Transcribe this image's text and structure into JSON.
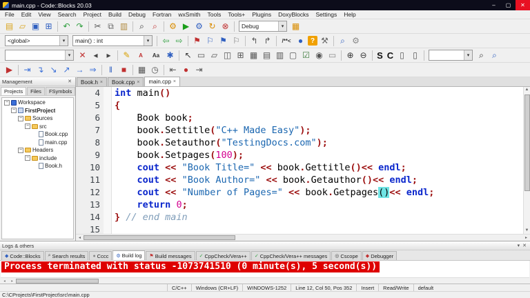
{
  "window": {
    "title": "main.cpp - Code::Blocks 20.03",
    "minimize": "–",
    "maximize": "▢",
    "close": "✕"
  },
  "menubar": [
    "File",
    "Edit",
    "View",
    "Search",
    "Project",
    "Build",
    "Debug",
    "Fortran",
    "wxSmith",
    "Tools",
    "Tools+",
    "Plugins",
    "DoxyBlocks",
    "Settings",
    "Help"
  ],
  "toolbars": {
    "debug_combo": "Debug",
    "scope_combo": "<global>",
    "symbol_combo": "main() : int",
    "row3_combo": "",
    "search_combo": "",
    "row1": [
      {
        "name": "new-file-icon",
        "glyph": "▤",
        "color": "#d9a520"
      },
      {
        "name": "open-file-icon",
        "glyph": "▱",
        "color": "#d9a520"
      },
      {
        "name": "save-icon",
        "glyph": "▣",
        "color": "#2f5fc0"
      },
      {
        "name": "save-all-icon",
        "glyph": "⊞",
        "color": "#2f5fc0"
      },
      {
        "sep": true
      },
      {
        "name": "undo-icon",
        "glyph": "↶",
        "color": "#2e9e3e"
      },
      {
        "name": "redo-icon",
        "glyph": "↷",
        "color": "#2e9e3e"
      },
      {
        "sep": true
      },
      {
        "name": "cut-icon",
        "glyph": "✂",
        "color": "#555555"
      },
      {
        "name": "copy-icon",
        "glyph": "⧉",
        "color": "#666666"
      },
      {
        "name": "paste-icon",
        "glyph": "▥",
        "color": "#b08a40"
      },
      {
        "sep": true
      },
      {
        "name": "find-icon",
        "glyph": "⌕",
        "color": "#333333"
      },
      {
        "name": "replace-icon",
        "glyph": "⌕",
        "color": "#c03030"
      },
      {
        "sep": true
      },
      {
        "name": "build-icon",
        "glyph": "⚙",
        "color": "#d98c00"
      },
      {
        "name": "run-icon",
        "glyph": "▶",
        "color": "#1a9e1a"
      },
      {
        "name": "build-and-run-icon",
        "glyph": "⚙",
        "color": "#2f5fc0"
      },
      {
        "name": "rebuild-icon",
        "glyph": "↻",
        "color": "#d98c00"
      },
      {
        "name": "abort-icon",
        "glyph": "⊗",
        "color": "#c03030"
      },
      {
        "sep": true
      }
    ],
    "row1b": [
      {
        "name": "select-target-icon",
        "glyph": "▦",
        "color": "#d98c00"
      }
    ],
    "row2": [
      {
        "sep": true
      },
      {
        "name": "goto-back-icon",
        "glyph": "⇦",
        "color": "#2e9e3e"
      },
      {
        "name": "goto-forward-icon",
        "glyph": "⇨",
        "color": "#2e9e3e"
      },
      {
        "sep": true
      },
      {
        "name": "toggle-bookmark-icon",
        "glyph": "⚑",
        "color": "#c03030"
      },
      {
        "name": "prev-bookmark-icon",
        "glyph": "⚐",
        "color": "#2f5fc0"
      },
      {
        "name": "next-bookmark-icon",
        "glyph": "⚑",
        "color": "#2f5fc0"
      },
      {
        "name": "clear-bookmarks-icon",
        "glyph": "⚐",
        "color": "#777777"
      },
      {
        "sep": true
      },
      {
        "name": "goto-declaration-icon",
        "glyph": "↰",
        "color": "#555555"
      },
      {
        "name": "goto-implementation-icon",
        "glyph": "↱",
        "color": "#555555"
      },
      {
        "sep": true
      },
      {
        "name": "doxy-block-comment-icon",
        "glyph": "/**<",
        "color": "#333333",
        "cls": "txt"
      },
      {
        "name": "doxy-run-icon",
        "glyph": "●",
        "color": "#2f5fc0"
      },
      {
        "name": "doxy-help-icon",
        "glyph": "?",
        "color": "#ffffff",
        "cls": "qbox"
      },
      {
        "name": "doxy-settings-icon",
        "glyph": "⚒",
        "color": "#666666"
      },
      {
        "sep": true
      },
      {
        "name": "find-in-files-icon",
        "glyph": "⌕",
        "color": "#2f5fc0"
      },
      {
        "name": "environment-options-icon",
        "glyph": "⚙",
        "color": "#888888"
      }
    ],
    "row3": [
      {
        "name": "incsearch-clear-icon",
        "glyph": "✕",
        "color": "#c03030"
      },
      {
        "name": "incsearch-prev-icon",
        "glyph": "◂",
        "color": "#444444"
      },
      {
        "name": "incsearch-next-icon",
        "glyph": "▸",
        "color": "#444444"
      },
      {
        "sep": true
      },
      {
        "name": "highlight-pen-icon",
        "glyph": "✎",
        "color": "#d8a000"
      },
      {
        "name": "highlight-a-icon",
        "glyph": "A",
        "color": "#c03030",
        "cls": "txt"
      },
      {
        "name": "match-case-icon",
        "glyph": "Aa",
        "color": "#333333",
        "cls": "txt"
      },
      {
        "name": "selection-star-icon",
        "glyph": "✱",
        "color": "#2f5fc0"
      },
      {
        "sep": true
      },
      {
        "name": "pointer-tool-icon",
        "glyph": "↖",
        "color": "#333333"
      },
      {
        "name": "frame-widget-icon",
        "glyph": "▭",
        "color": "#555555"
      },
      {
        "name": "panel-widget-icon",
        "glyph": "▱",
        "color": "#555555"
      },
      {
        "name": "splitter-widget-icon",
        "glyph": "◫",
        "color": "#555555"
      },
      {
        "name": "notebook-widget-icon",
        "glyph": "⊞",
        "color": "#555555"
      },
      {
        "name": "sizer-widget-icon",
        "glyph": "▦",
        "color": "#555555"
      },
      {
        "name": "grid-widget-icon",
        "glyph": "▤",
        "color": "#555555"
      },
      {
        "name": "listbox-widget-icon",
        "glyph": "▥",
        "color": "#555555"
      },
      {
        "name": "button-widget-icon",
        "glyph": "▢",
        "color": "#555555"
      },
      {
        "name": "checkbox-widget-icon",
        "glyph": "☑",
        "color": "#3a7a3a"
      },
      {
        "name": "radio-widget-icon",
        "glyph": "◉",
        "color": "#555555"
      },
      {
        "name": "statictext-widget-icon",
        "glyph": "▭",
        "color": "#888888"
      },
      {
        "sep": true
      },
      {
        "name": "zoom-in-icon",
        "glyph": "⊕",
        "color": "#333333"
      },
      {
        "name": "zoom-out-icon",
        "glyph": "⊖",
        "color": "#333333"
      },
      {
        "sep": true
      },
      {
        "name": "letter-s-tool-icon",
        "glyph": "S",
        "color": "#111111",
        "cls": "big"
      },
      {
        "name": "letter-c-tool-icon",
        "glyph": "C",
        "color": "#111111",
        "cls": "big"
      },
      {
        "name": "box-tool-icon",
        "glyph": "▯",
        "color": "#555555"
      },
      {
        "name": "box-tool-2-icon",
        "glyph": "▯",
        "color": "#555555"
      },
      {
        "sep": true
      }
    ],
    "row3b": [
      {
        "name": "search-find-icon",
        "glyph": "⌕",
        "color": "#333333"
      },
      {
        "name": "search-find-selected-icon",
        "glyph": "⌕",
        "color": "#2f5fc0"
      }
    ],
    "row4": [
      {
        "name": "debugger-continue-icon",
        "glyph": "▶",
        "color": "#c03030"
      },
      {
        "sep": true
      },
      {
        "name": "run-to-cursor-icon",
        "glyph": "⇥",
        "color": "#3a6fd8"
      },
      {
        "name": "next-line-icon",
        "glyph": "↴",
        "color": "#3a6fd8"
      },
      {
        "name": "step-into-icon",
        "glyph": "↘",
        "color": "#3a6fd8"
      },
      {
        "name": "step-out-icon",
        "glyph": "↗",
        "color": "#3a6fd8"
      },
      {
        "name": "next-instruction-icon",
        "glyph": "→",
        "color": "#3a6fd8"
      },
      {
        "name": "step-into-instruction-icon",
        "glyph": "⇒",
        "color": "#3a6fd8"
      },
      {
        "sep": true
      },
      {
        "name": "break-debugger-icon",
        "glyph": "‖",
        "color": "#2f5fc0"
      },
      {
        "name": "stop-debugger-icon",
        "glyph": "■",
        "color": "#c03030"
      },
      {
        "sep": true
      },
      {
        "name": "debugging-windows-icon",
        "glyph": "▦",
        "color": "#555555"
      },
      {
        "name": "various-info-icon",
        "glyph": "◷",
        "color": "#555555"
      },
      {
        "sep": true
      },
      {
        "name": "goto-first-icon",
        "glyph": "⇤",
        "color": "#555555"
      },
      {
        "name": "current-position-icon",
        "glyph": "●",
        "color": "#c03030"
      },
      {
        "name": "goto-last-icon",
        "glyph": "⇥",
        "color": "#555555"
      }
    ]
  },
  "management": {
    "title": "Management",
    "close_glyph": "✕",
    "tabs": [
      {
        "label": "Projects",
        "active": true
      },
      {
        "label": "Files"
      },
      {
        "label": "FSymbols"
      }
    ],
    "tree": [
      {
        "label": "Workspace",
        "depth": 0,
        "icon": "workspace",
        "expander": true
      },
      {
        "label": "FirstProject",
        "depth": 1,
        "icon": "project",
        "bold": true,
        "expander": true
      },
      {
        "label": "Sources",
        "depth": 2,
        "icon": "folder",
        "expander": true
      },
      {
        "label": "src",
        "depth": 3,
        "icon": "folder",
        "expander": true
      },
      {
        "label": "Book.cpp",
        "depth": 4,
        "icon": "file"
      },
      {
        "label": "main.cpp",
        "depth": 4,
        "icon": "file"
      },
      {
        "label": "Headers",
        "depth": 2,
        "icon": "folder",
        "expander": true
      },
      {
        "label": "include",
        "depth": 3,
        "icon": "folder",
        "expander": true
      },
      {
        "label": "Book.h",
        "depth": 4,
        "icon": "file"
      }
    ]
  },
  "editor": {
    "tabs": [
      {
        "label": "Book.h",
        "close": true
      },
      {
        "label": "Book.cpp",
        "close": true
      },
      {
        "label": "main.cpp",
        "close": true,
        "active": true
      }
    ],
    "lines": [
      {
        "n": 4,
        "segs": [
          [
            "k",
            "int"
          ],
          [
            "p",
            " main"
          ],
          [
            "o",
            "()"
          ]
        ]
      },
      {
        "n": 5,
        "segs": [
          [
            "o",
            "{"
          ]
        ]
      },
      {
        "n": 6,
        "segs": [
          [
            "p",
            "    Book book"
          ],
          [
            "o",
            ";"
          ]
        ]
      },
      {
        "n": 7,
        "segs": [
          [
            "p",
            "    book"
          ],
          [
            "o",
            "."
          ],
          [
            "p",
            "Settitle"
          ],
          [
            "o",
            "("
          ],
          [
            "s",
            "\"C++ Made Easy\""
          ],
          [
            "o",
            ");"
          ]
        ]
      },
      {
        "n": 8,
        "segs": [
          [
            "p",
            "    book"
          ],
          [
            "o",
            "."
          ],
          [
            "p",
            "Setauthor"
          ],
          [
            "o",
            "("
          ],
          [
            "s",
            "\"TestingDocs.com\""
          ],
          [
            "o",
            ");"
          ]
        ]
      },
      {
        "n": 9,
        "segs": [
          [
            "p",
            "    book"
          ],
          [
            "o",
            "."
          ],
          [
            "p",
            "Setpages"
          ],
          [
            "o",
            "("
          ],
          [
            "num",
            "100"
          ],
          [
            "o",
            ");"
          ]
        ]
      },
      {
        "n": 10,
        "segs": [
          [
            "p",
            "    "
          ],
          [
            "k",
            "cout"
          ],
          [
            "p",
            " "
          ],
          [
            "o",
            "<<"
          ],
          [
            "p",
            " "
          ],
          [
            "s",
            "\"Book Title=\""
          ],
          [
            "p",
            " "
          ],
          [
            "o",
            "<<"
          ],
          [
            "p",
            " book"
          ],
          [
            "o",
            "."
          ],
          [
            "p",
            "Gettitle"
          ],
          [
            "o",
            "()<<"
          ],
          [
            "p",
            " "
          ],
          [
            "k",
            "endl"
          ],
          [
            "o",
            ";"
          ]
        ]
      },
      {
        "n": 11,
        "segs": [
          [
            "p",
            "    "
          ],
          [
            "k",
            "cout"
          ],
          [
            "p",
            " "
          ],
          [
            "o",
            "<<"
          ],
          [
            "p",
            " "
          ],
          [
            "s",
            "\"Book Author=\""
          ],
          [
            "p",
            " "
          ],
          [
            "o",
            "<<"
          ],
          [
            "p",
            " book"
          ],
          [
            "o",
            "."
          ],
          [
            "p",
            "Getauthor"
          ],
          [
            "o",
            "()<<"
          ],
          [
            "p",
            " "
          ],
          [
            "k",
            "endl"
          ],
          [
            "o",
            ";"
          ]
        ]
      },
      {
        "n": 12,
        "segs": [
          [
            "p",
            "    "
          ],
          [
            "k",
            "cout"
          ],
          [
            "p",
            " "
          ],
          [
            "o",
            "<<"
          ],
          [
            "p",
            " "
          ],
          [
            "s",
            "\"Number of Pages=\""
          ],
          [
            "p",
            " "
          ],
          [
            "o",
            "<<"
          ],
          [
            "p",
            " book"
          ],
          [
            "o",
            "."
          ],
          [
            "p",
            "Getpages"
          ],
          [
            "h",
            "()"
          ],
          [
            "o",
            "<<"
          ],
          [
            "p",
            " "
          ],
          [
            "k",
            "endl"
          ],
          [
            "o",
            ";"
          ]
        ]
      },
      {
        "n": 13,
        "segs": [
          [
            "p",
            "    "
          ],
          [
            "k",
            "return"
          ],
          [
            "p",
            " "
          ],
          [
            "num",
            "0"
          ],
          [
            "o",
            ";"
          ]
        ]
      },
      {
        "n": 14,
        "segs": [
          [
            "o",
            "}"
          ],
          [
            "p",
            " "
          ],
          [
            "c",
            "// end main"
          ]
        ]
      },
      {
        "n": 15,
        "segs": []
      }
    ]
  },
  "logs": {
    "title": "Logs & others",
    "close_glyph": "✕",
    "menu_glyph": "▾",
    "tabs": [
      {
        "label": "Code::Blocks",
        "icon": "◆",
        "color": "#2f5fc0",
        "iname": "codeblocks-logo-icon"
      },
      {
        "label": "Search results",
        "icon": "⌕",
        "color": "#444444",
        "iname": "search-icon"
      },
      {
        "label": "Cccc",
        "icon": "●",
        "color": "#888888",
        "iname": "cccc-icon"
      },
      {
        "label": "Build log",
        "icon": "⚙",
        "color": "#2f5fc0",
        "active": true,
        "iname": "build-log-icon"
      },
      {
        "label": "Build messages",
        "icon": "⚑",
        "color": "#c03030",
        "iname": "flag-icon"
      },
      {
        "label": "CppCheck/Vera++",
        "icon": "✓",
        "color": "#2e9e3e",
        "iname": "check-icon"
      },
      {
        "label": "CppCheck/Vera++ messages",
        "icon": "✓",
        "color": "#2e9e3e",
        "iname": "check-icon"
      },
      {
        "label": "Cscope",
        "icon": "◎",
        "color": "#444444",
        "iname": "cscope-icon"
      },
      {
        "label": "Debugger",
        "icon": "◆",
        "color": "#c03030",
        "iname": "debugger-icon"
      }
    ],
    "message": "Process terminated with status -1073741510 (0 minute(s), 5 second(s))"
  },
  "statusbar": {
    "cells": [
      "",
      "C/C++",
      "Windows (CR+LF)",
      "WINDOWS-1252",
      "Line 12, Col 50, Pos 352",
      "Insert",
      "Read/Write",
      "default"
    ],
    "path": "C:\\CProjects\\FirstProject\\src\\main.cpp"
  }
}
